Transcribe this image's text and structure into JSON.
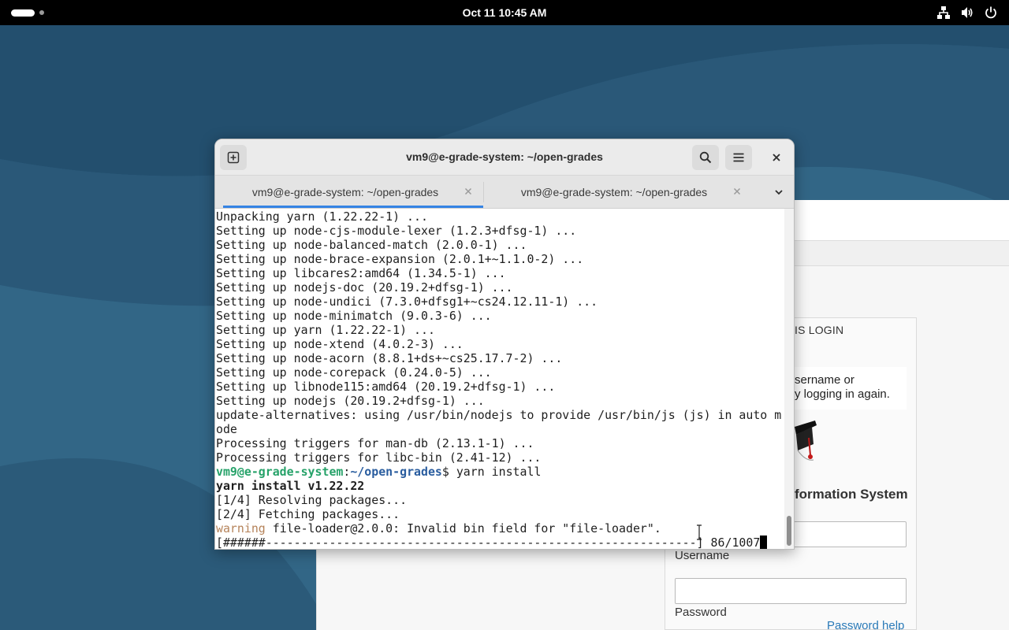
{
  "topbar": {
    "clock": "Oct 11  10:45 AM",
    "icons": [
      "activities-indicator",
      "network-icon",
      "volume-icon",
      "power-icon"
    ]
  },
  "background_app": {
    "login_heading": "IS LOGIN",
    "message_line1": "sername or",
    "message_line2": "y logging in again.",
    "system_name": "formation System",
    "username_label": "Username",
    "password_label": "Password",
    "password_help": "Password help"
  },
  "terminal": {
    "title": "vm9@e-grade-system: ~/open-grades",
    "new_tab_icon": "new-tab-icon",
    "search_icon": "search-icon",
    "menu_icon": "hamburger-menu-icon",
    "close_icon": "close-icon",
    "tabs": [
      {
        "label": "vm9@e-grade-system: ~/open-grades",
        "active": true
      },
      {
        "label": "vm9@e-grade-system: ~/open-grades",
        "active": false
      }
    ],
    "lines": [
      "Unpacking yarn (1.22.22-1) ...",
      "Setting up node-cjs-module-lexer (1.2.3+dfsg-1) ...",
      "Setting up node-balanced-match (2.0.0-1) ...",
      "Setting up node-brace-expansion (2.0.1+~1.1.0-2) ...",
      "Setting up libcares2:amd64 (1.34.5-1) ...",
      "Setting up nodejs-doc (20.19.2+dfsg-1) ...",
      "Setting up node-undici (7.3.0+dfsg1+~cs24.12.11-1) ...",
      "Setting up node-minimatch (9.0.3-6) ...",
      "Setting up yarn (1.22.22-1) ...",
      "Setting up node-xtend (4.0.2-3) ...",
      "Setting up node-acorn (8.8.1+ds+~cs25.17.7-2) ...",
      "Setting up node-corepack (0.24.0-5) ...",
      "Setting up libnode115:amd64 (20.19.2+dfsg-1) ...",
      "Setting up nodejs (20.19.2+dfsg-1) ...",
      "update-alternatives: using /usr/bin/nodejs to provide /usr/bin/js (js) in auto m",
      "ode",
      "Processing triggers for man-db (2.13.1-1) ...",
      "Processing triggers for libc-bin (2.41-12) ..."
    ],
    "prompt_user": "vm9@e-grade-system",
    "prompt_sep": ":",
    "prompt_path": "~/open-grades",
    "prompt_symbol": "$ ",
    "command": "yarn install",
    "yarn_header": "yarn install v1.22.22",
    "step1": "[1/4] Resolving packages...",
    "step2": "[2/4] Fetching packages...",
    "warning_label": "warning",
    "warning_text": " file-loader@2.0.0: Invalid bin field for \"file-loader\".",
    "progress_line": "[######-------------------------------------------------------------] 86/1007",
    "progress_fraction": 0.085
  },
  "colors": {
    "prompt_user": "#26a269",
    "prompt_path": "#2a5d9f",
    "warning": "#b5835a",
    "tab_accent": "#3584e4",
    "wallpaper": "#2b5b7c"
  }
}
